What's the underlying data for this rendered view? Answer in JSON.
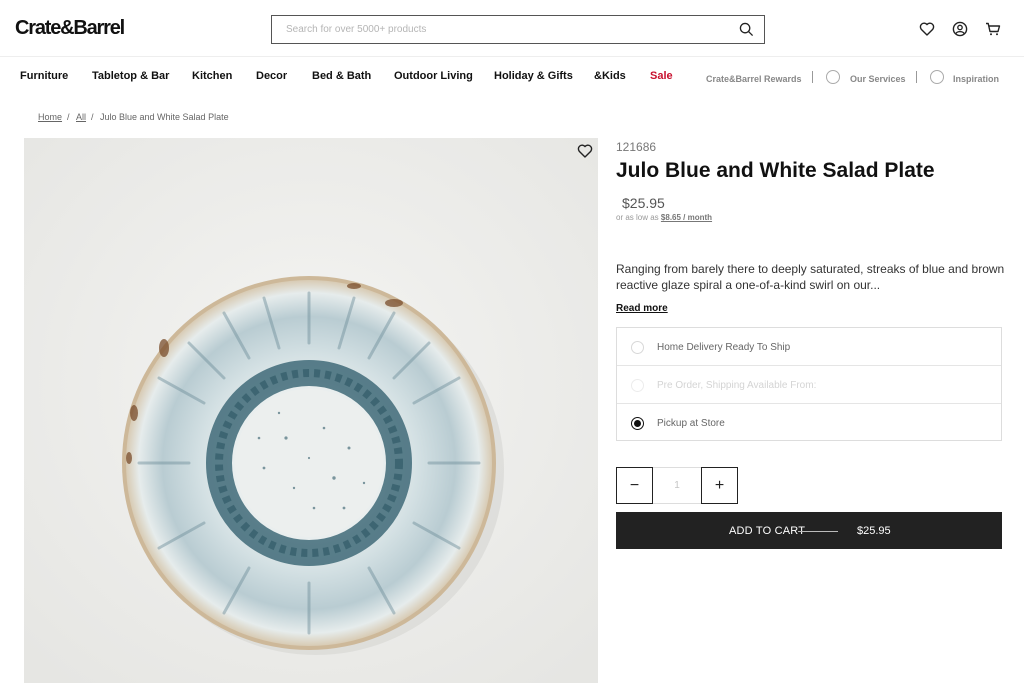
{
  "header": {
    "logo": "Crate&Barrel",
    "search_placeholder": "Search for over 5000+ products",
    "icons": [
      "search-icon",
      "heart-icon",
      "account-icon",
      "cart-icon"
    ]
  },
  "nav": {
    "items": [
      "Furniture",
      "Tabletop & Bar",
      "Kitchen",
      "Decor",
      "Bed & Bath",
      "Outdoor Living",
      "Holiday & Gifts",
      "&Kids",
      "Sale"
    ],
    "right": {
      "rewards": "Crate&Barrel Rewards",
      "services": "Our Services",
      "inspiration": "Inspiration"
    }
  },
  "breadcrumb": {
    "home": "Home",
    "all": "All",
    "current": "Julo Blue and White Salad Plate",
    "sep": "/"
  },
  "product": {
    "sku": "121686",
    "title": "Julo Blue and White Salad Plate",
    "price": "$25.95",
    "finance_prefix": "or as low as",
    "finance_amount": "$8.65 / month",
    "description": "Ranging from barely there to deeply saturated, streaks of blue and brown reactive glaze spiral a one-of-a-kind swirl on our...",
    "read_more": "Read more",
    "options": [
      {
        "label": "Home Delivery Ready To Ship",
        "selected": false,
        "disabled": false
      },
      {
        "label": "Pre Order, Shipping Available From:",
        "selected": false,
        "disabled": true
      },
      {
        "label": "Pickup at Store",
        "selected": true,
        "disabled": false
      }
    ],
    "quantity": "1",
    "minus": "−",
    "plus": "+",
    "add_to_cart": "ADD TO CART",
    "cart_price": "$25.95"
  },
  "colors": {
    "sale": "#c8102e",
    "button": "#222222"
  }
}
